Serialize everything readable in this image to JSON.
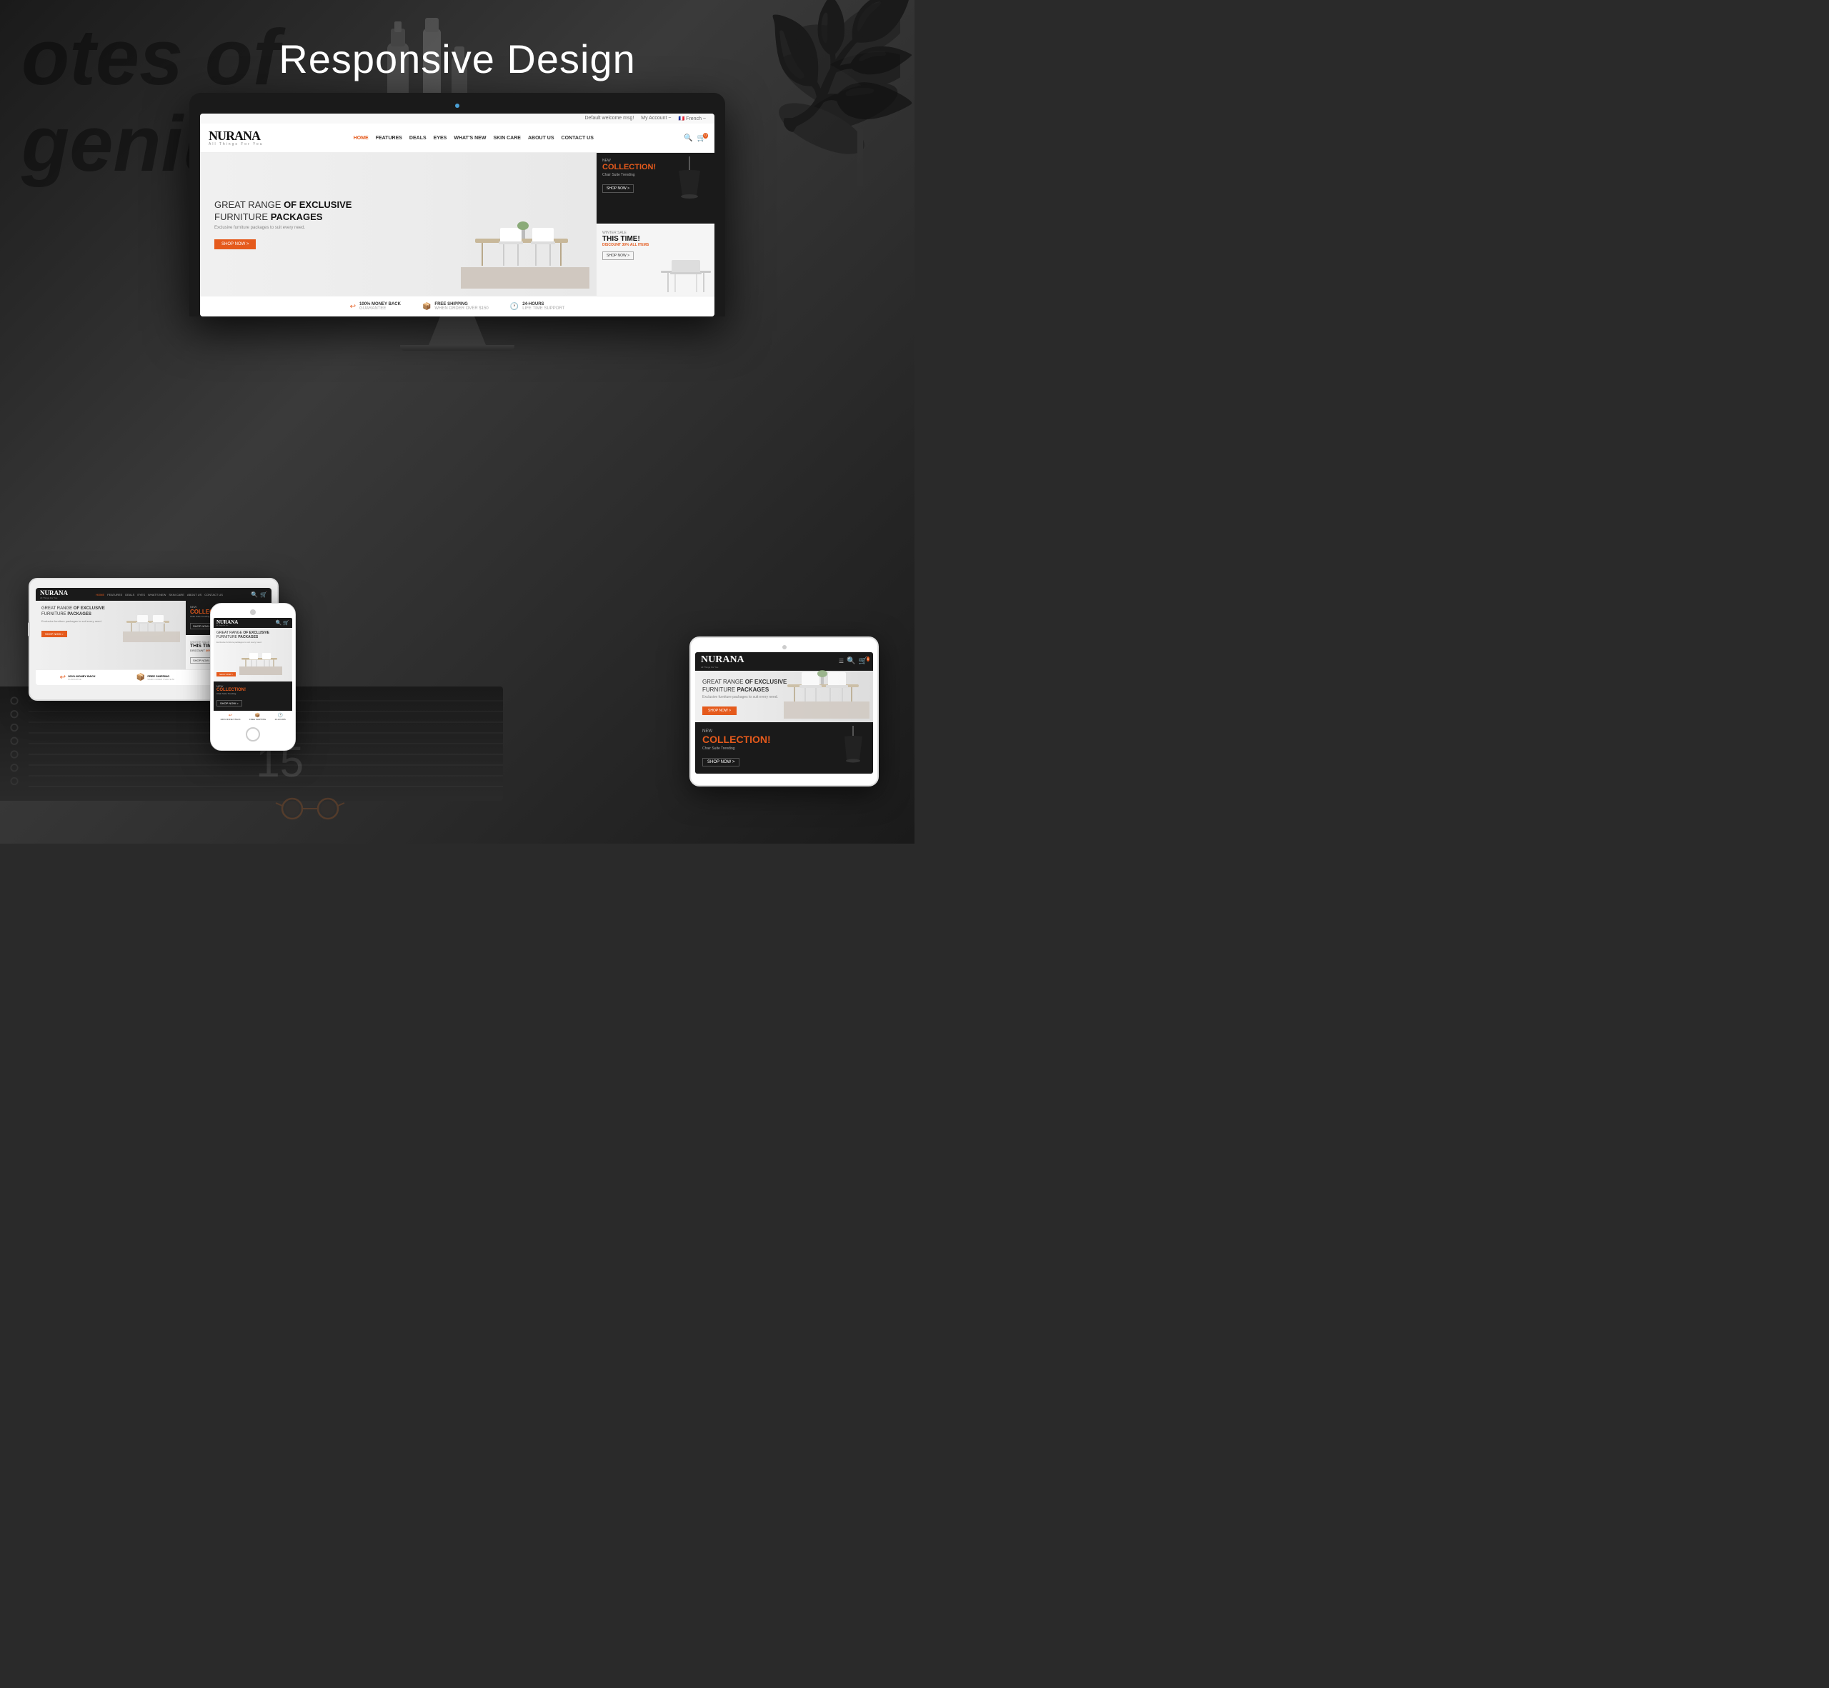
{
  "page": {
    "heading": "Responsive Design",
    "bg_text_line1": "otes of",
    "bg_text_line2": "genius"
  },
  "website": {
    "topbar": {
      "welcome": "Default welcome msg!",
      "account": "My Account ~",
      "language": "🇫🇷 French ~"
    },
    "logo": {
      "name": "NURANA",
      "tagline": "All Things For You"
    },
    "nav": {
      "items": [
        {
          "label": "HOME",
          "active": true
        },
        {
          "label": "FEATURES",
          "active": false
        },
        {
          "label": "DEALS",
          "active": false
        },
        {
          "label": "EYES",
          "active": false
        },
        {
          "label": "WHAT'S NEW",
          "active": false
        },
        {
          "label": "SKIN CARE",
          "active": false
        },
        {
          "label": "ABOUT US",
          "active": false
        },
        {
          "label": "CONTACT US",
          "active": false
        }
      ]
    },
    "hero": {
      "tag": "GREAT RANGE",
      "title_bold": "OF EXCLUSIVE",
      "title2": "FURNITURE",
      "title2_bold": "PACKAGES",
      "subtitle": "Exclusive furniture packages to suit every need.",
      "cta": "SHOP NOW >"
    },
    "side_top": {
      "label": "NEW",
      "title": "COLLECTION!",
      "subtitle": "Chair Suite Trending",
      "cta": "SHOP NOW >"
    },
    "side_bottom": {
      "label": "WINTER SALE",
      "title": "THIS TIME!",
      "discount_text": "DISCOUNT",
      "discount_pct": "30%",
      "discount_suffix": "ALL ITEMS",
      "cta": "SHOP NOW >"
    },
    "features": [
      {
        "icon": "↩",
        "title": "100% MONEY BACK",
        "subtitle": "GUARANTEE"
      },
      {
        "icon": "📦",
        "title": "FREE SHIPPING",
        "subtitle": "WHEN ORDER OVER $150"
      },
      {
        "icon": "🕐",
        "title": "24-HOURS",
        "subtitle": "LIFE TIME SUPPORT"
      }
    ]
  },
  "devices": {
    "monitor": {
      "label": "Desktop Monitor"
    },
    "tablet_left": {
      "label": "Tablet Left"
    },
    "phone": {
      "label": "Phone"
    },
    "tablet_right": {
      "label": "Tablet Right"
    }
  }
}
